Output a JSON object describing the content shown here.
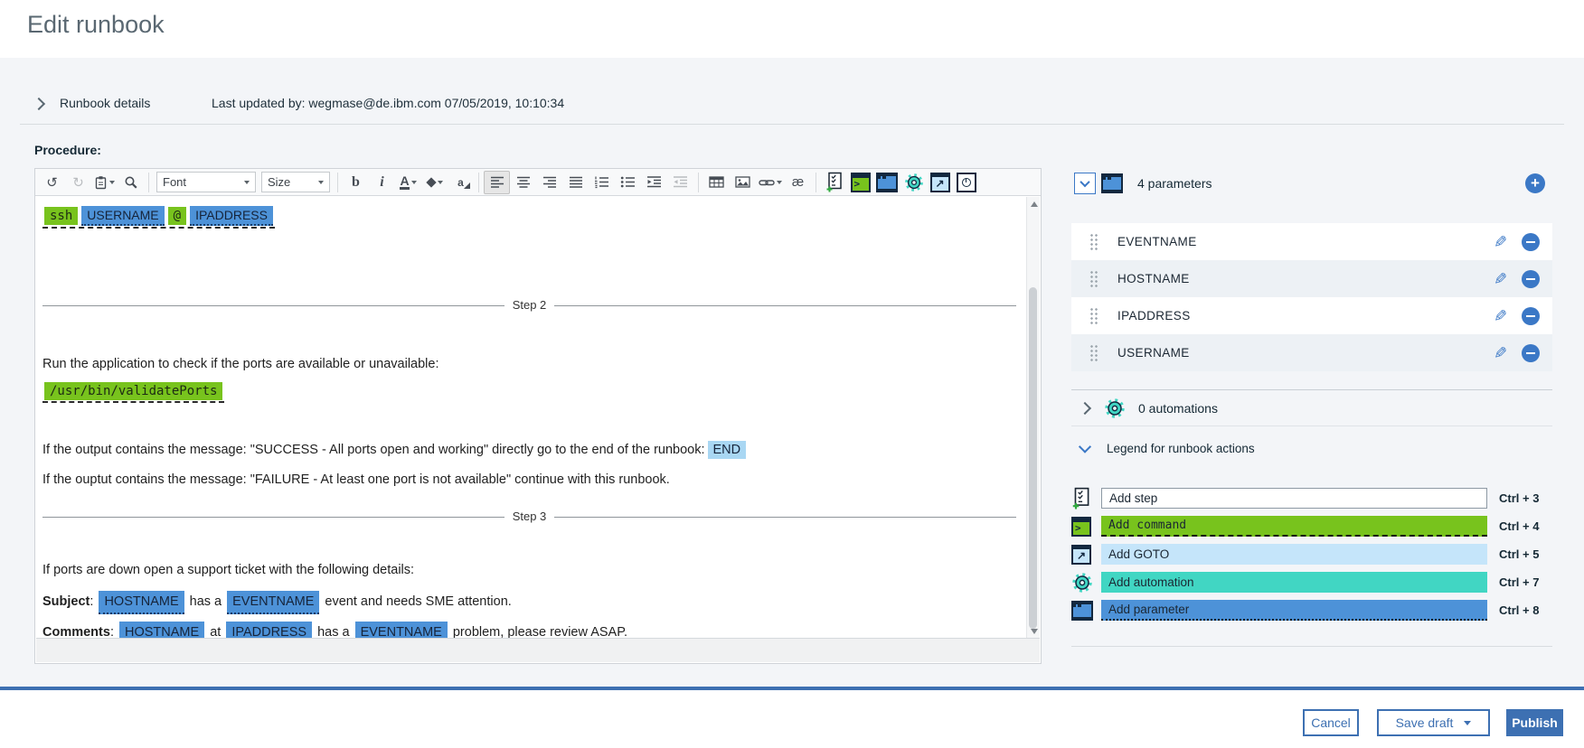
{
  "header": {
    "title": "Edit runbook"
  },
  "details": {
    "label": "Runbook details",
    "last_updated": "Last updated by: wegmase@de.ibm.com 07/05/2019, 10:10:34"
  },
  "procedure_label": "Procedure:",
  "toolbar": {
    "font": "Font",
    "size": "Size"
  },
  "icons": {
    "undo": "↺",
    "redo": "↻",
    "bold": "b",
    "italic": "i",
    "text_color": "A",
    "text_bg": "a",
    "special_char": "æ",
    "prompt": ">",
    "goto_arrow": "↗",
    "plus": "+",
    "pencil": "✎"
  },
  "editor": {
    "step1": {
      "cmd": "ssh",
      "user": "USERNAME",
      "at": "@",
      "ip": "IPADDRESS"
    },
    "step2_divider": "Step 2",
    "step2": {
      "intro": "Run the application to check if the ports are available or unavailable:",
      "command": "/usr/bin/validatePorts",
      "success_pre": "If the output contains the message: \"SUCCESS - All ports open and working\" directly go to the end of the runbook:",
      "goto_chip": "END",
      "failure": "If the ouptut contains the message: \"FAILURE - At least one port is not available\" continue with this runbook."
    },
    "step3_divider": "Step 3",
    "step3": {
      "intro": "If ports are down open a support ticket with the following details:",
      "subject_label": "Subject",
      "subject_sep": ": ",
      "subject_p1": "HOSTNAME",
      "subject_t1": " has a ",
      "subject_p2": "EVENTNAME",
      "subject_t2": " event and needs SME attention.",
      "comments_label": "Comments",
      "comments_sep": ": ",
      "comments_p1": "HOSTNAME",
      "comments_t1": " at ",
      "comments_p2": "IPADDRESS",
      "comments_t2": " has a ",
      "comments_p3": "EVENTNAME",
      "comments_t3": " problem, please review ASAP."
    }
  },
  "parameters": {
    "header": "4 parameters",
    "items": [
      {
        "name": "EVENTNAME"
      },
      {
        "name": "HOSTNAME"
      },
      {
        "name": "IPADDRESS"
      },
      {
        "name": "USERNAME"
      }
    ]
  },
  "automations": {
    "header": "0 automations"
  },
  "legend": {
    "header": "Legend for runbook actions",
    "items": [
      {
        "label": "Add step",
        "shortcut": "Ctrl + 3"
      },
      {
        "label": "Add command",
        "shortcut": "Ctrl + 4"
      },
      {
        "label": "Add GOTO",
        "shortcut": "Ctrl + 5"
      },
      {
        "label": "Add automation",
        "shortcut": "Ctrl + 7"
      },
      {
        "label": "Add parameter",
        "shortcut": "Ctrl + 8"
      }
    ]
  },
  "footer": {
    "cancel": "Cancel",
    "save_draft": "Save draft",
    "publish": "Publish"
  },
  "colors": {
    "command_green": "#78c31d",
    "parameter_blue": "#4d92d8",
    "goto_light_blue": "#c5e5fa",
    "goto_chip_blue": "#a9d7f3",
    "automation_teal": "#41d6c3",
    "accent_blue": "#3d70b2"
  }
}
